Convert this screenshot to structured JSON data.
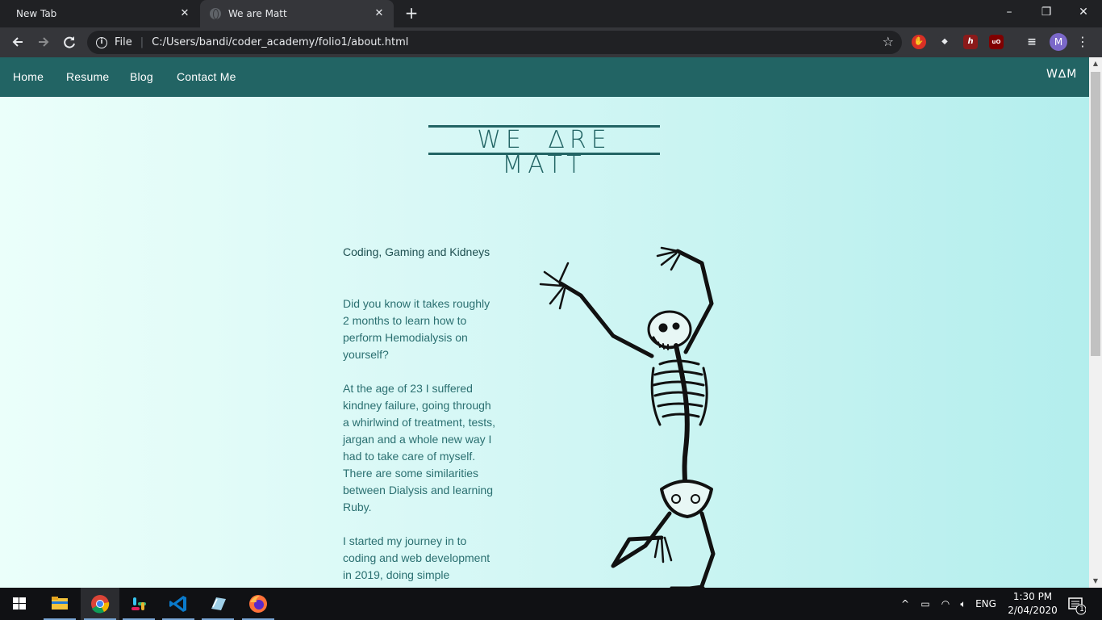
{
  "browser": {
    "tabs": [
      {
        "title": "New Tab",
        "active": false
      },
      {
        "title": "We are Matt",
        "active": true
      }
    ],
    "new_tab_symbol": "+",
    "window_controls": {
      "minimize": "–",
      "restore": "❐",
      "close": "✕"
    },
    "address_bar": {
      "scheme_label": "File",
      "separator": "|",
      "url": "C:/Users/bandi/coder_academy/folio1/about.html"
    },
    "profile_initial": "M",
    "extensions": [
      {
        "name": "adblock-extension-icon",
        "color": "#d93025",
        "glyph": "✋"
      },
      {
        "name": "puzzle-extension-icon",
        "color": "#35363a",
        "glyph": "⬥"
      },
      {
        "name": "h-extension-icon",
        "color": "#8b1a1a",
        "glyph": "h"
      },
      {
        "name": "ublock-extension-icon",
        "color": "#800000",
        "glyph": "uO"
      }
    ]
  },
  "page": {
    "nav": {
      "links": [
        "Home",
        "Resume",
        "Blog",
        "Contact Me"
      ],
      "logo": "W∆M"
    },
    "hero_title": "WE ∆RE MATT",
    "subtitle": "Coding, Gaming and Kidneys",
    "paragraphs": [
      "Did you know it takes roughly 2 months to learn how to perform Hemodialysis on yourself?",
      "At the age of 23 I suffered kindney failure, going through a whirlwind of treatment, tests, jargan and a whole new way I had to take care of myself. There are some similarities between Dialysis and learning Ruby.",
      "I started my journey in to coding and web development in 2019, doing simple"
    ],
    "colors": {
      "nav_bg": "#226464",
      "title_color": "#226464",
      "text_color": "#2a6f70",
      "bg_gradient_start": "#ebfffa",
      "bg_gradient_end": "#b3eeed"
    }
  },
  "taskbar": {
    "apps": [
      "file-explorer-icon",
      "chrome-icon",
      "slack-icon",
      "vscode-icon",
      "notepad-icon",
      "firefox-icon"
    ],
    "tray": {
      "language": "ENG",
      "time": "1:30 PM",
      "date": "2/04/2020",
      "notification_count": "1"
    }
  }
}
